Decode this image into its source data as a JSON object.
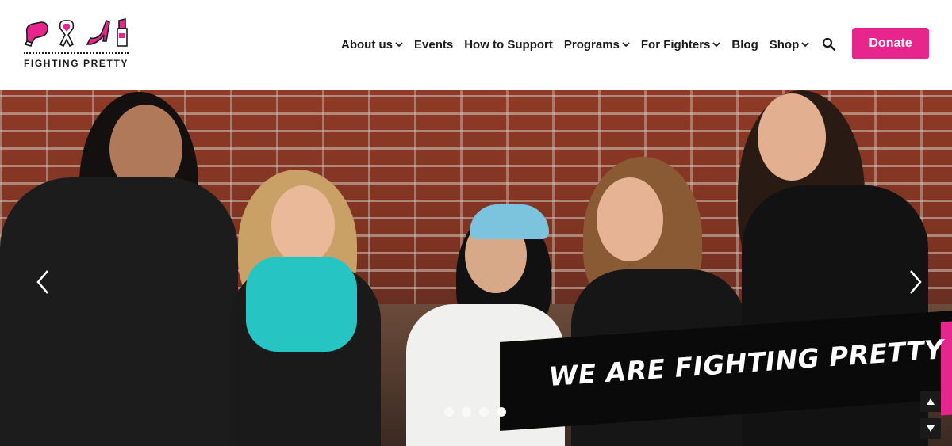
{
  "brand": {
    "name": "FIGHTING PRETTY",
    "accent_color": "#e6268c",
    "logo_icons": [
      "boxing-glove-icon",
      "ribbon-icon",
      "high-heel-icon",
      "lipstick-icon"
    ]
  },
  "nav": {
    "items": [
      {
        "label": "About us",
        "has_dropdown": true
      },
      {
        "label": "Events",
        "has_dropdown": false
      },
      {
        "label": "How to Support",
        "has_dropdown": false
      },
      {
        "label": "Programs",
        "has_dropdown": true
      },
      {
        "label": "For Fighters",
        "has_dropdown": true
      },
      {
        "label": "Blog",
        "has_dropdown": false
      },
      {
        "label": "Shop",
        "has_dropdown": true
      }
    ],
    "search_icon": "search-icon",
    "donate_label": "Donate"
  },
  "hero": {
    "banner_text": "WE ARE FIGHTING PRETTY",
    "slides": 4,
    "active_slide": 4,
    "prev_icon": "chevron-left-icon",
    "next_icon": "chevron-right-icon"
  },
  "scroll": {
    "up_icon": "arrow-up-icon",
    "down_icon": "arrow-down-icon"
  }
}
